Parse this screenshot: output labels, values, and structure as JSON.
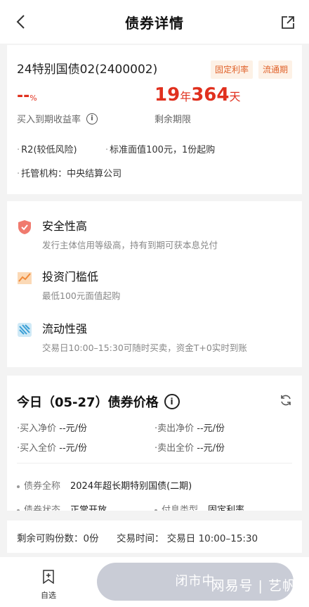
{
  "header": {
    "title": "债券详情",
    "back_icon": "chevron-left-icon",
    "share_icon": "share-out-icon"
  },
  "bond": {
    "name": "24特别国债02(2400002)",
    "tags": [
      "固定利率",
      "流通期"
    ],
    "yield_value": "--",
    "yield_unit": "%",
    "yield_label": "买入到期收益率",
    "term_years": "19",
    "term_year_unit": "年",
    "term_days": "364",
    "term_day_unit": "天",
    "term_label": "剩余期限",
    "risk": "R2(较低风险)",
    "par": "标准面值100元，1份起购",
    "custodian": "托管机构：中央结算公司"
  },
  "features": [
    {
      "icon": "shield-icon",
      "title": "安全性高",
      "desc": "发行主体信用等级高，持有到期可获本息兑付"
    },
    {
      "icon": "trend-chart-icon",
      "title": "投资门槛低",
      "desc": "最低100元面值起购"
    },
    {
      "icon": "liquidity-icon",
      "title": "流动性强",
      "desc": "交易日10:00–15:30可随时买卖，资金T+0实时到账"
    }
  ],
  "price": {
    "title": "今日（05-27）债券价格",
    "buy_net_label": "买入净价",
    "buy_net_value": "--元/份",
    "sell_net_label": "卖出净价",
    "sell_net_value": "--元/份",
    "buy_full_label": "买入全价",
    "buy_full_value": "--元/份",
    "sell_full_label": "卖出全价",
    "sell_full_value": "--元/份"
  },
  "details": {
    "fullname_label": "债券全称",
    "fullname_value": "2024年超长期特别国债(二期)",
    "status_label": "债券状态",
    "status_value": "正常开放",
    "coupon_label": "付息类型",
    "coupon_value": "固定利率"
  },
  "strip": {
    "remaining": "剩余可购份数：0份",
    "trade_time": "交易时间：  交易日 10:00–15:30"
  },
  "bottom": {
    "watch_label": "自选",
    "buy_label": "闭市中",
    "watermark": "网易号 | 艺帆"
  },
  "colors": {
    "accent_red": "#e0301e",
    "tag_orange": "#e0622a",
    "tag_bg": "#fdf1e6",
    "button_gray": "#c9ccd6"
  }
}
